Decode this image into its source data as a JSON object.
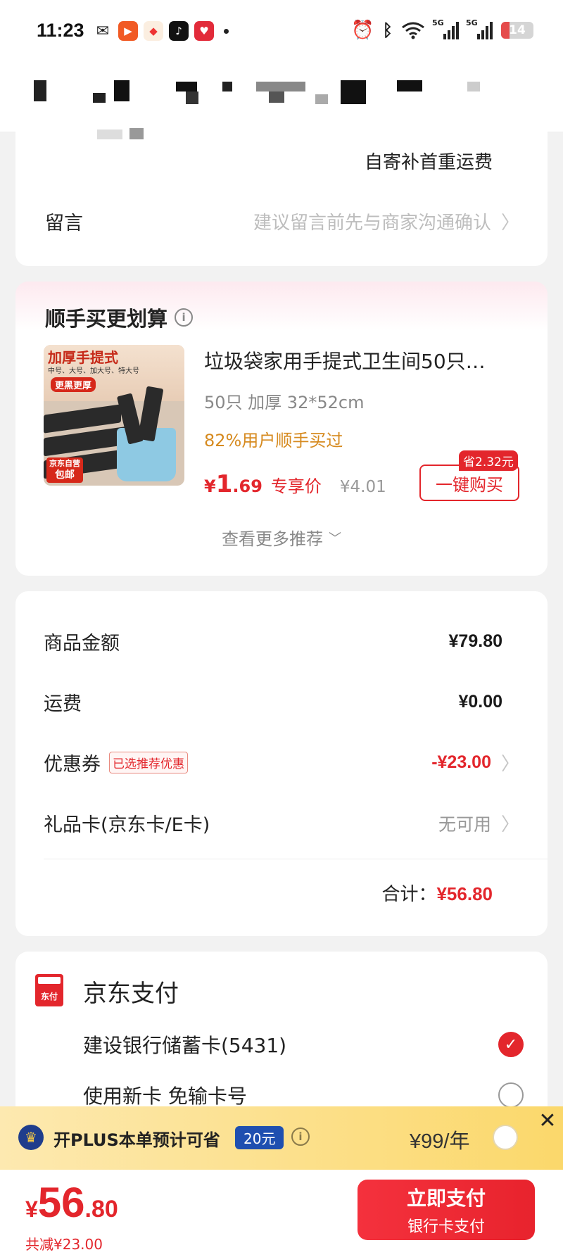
{
  "status_bar": {
    "time": "11:23",
    "battery": "14",
    "signal_labels": [
      "5G",
      "5G"
    ],
    "app_icons": [
      "wechat-icon",
      "video-app-icon",
      "shop-app-icon",
      "tiktok-icon",
      "pinduoduo-icon"
    ]
  },
  "top_card": {
    "shipping_note": "自寄补首重运费",
    "message_label": "留言",
    "message_hint": "建议留言前先与商家沟通确认"
  },
  "recommend": {
    "title": "顺手买更划算",
    "product": {
      "image_title": "加厚手提式",
      "image_sizes": "中号、大号、加大号、特大号",
      "image_tag": "更黑更厚",
      "image_badge_line1": "京东自营",
      "image_badge_line2": "包邮",
      "name": "垃圾袋家用手提式卫生间50只…",
      "spec": "50只 加厚 32*52cm",
      "buyers": "82%用户顺手买过",
      "price_symbol": "¥",
      "price_int": "1",
      "price_dec": ".69",
      "price_label": "专享价",
      "original_price": "¥4.01",
      "save_tag": "省2.32元",
      "buy_button": "一键购买"
    },
    "more": "查看更多推荐"
  },
  "amounts": {
    "goods_label": "商品金额",
    "goods_value": "¥79.80",
    "shipping_label": "运费",
    "shipping_value": "¥0.00",
    "coupon_label": "优惠券",
    "coupon_tag": "已选推荐优惠",
    "coupon_value": "-¥23.00",
    "giftcard_label": "礼品卡(京东卡/E卡)",
    "giftcard_value": "无可用",
    "total_label": "合计：",
    "total_value": "¥56.80"
  },
  "payment": {
    "icon_text": "东付",
    "title": "京东支付",
    "options": [
      {
        "label": "建设银行储蓄卡(5431)",
        "selected": true
      },
      {
        "label": "使用新卡 免输卡号",
        "selected": false
      }
    ]
  },
  "plus_bar": {
    "text": "开PLUS本单预计可省",
    "badge": "20元",
    "price": "¥99/年"
  },
  "bottom": {
    "price_symbol": "¥",
    "price_int": "56",
    "price_dec": ".80",
    "saved": "共减¥23.00",
    "pay_main": "立即支付",
    "pay_sub": "银行卡支付"
  },
  "colors": {
    "accent_red": "#e3262c",
    "buyers_orange": "#d68a1f",
    "plus_blue": "#1f4fb0",
    "plus_yellow": "#fbd86b"
  }
}
